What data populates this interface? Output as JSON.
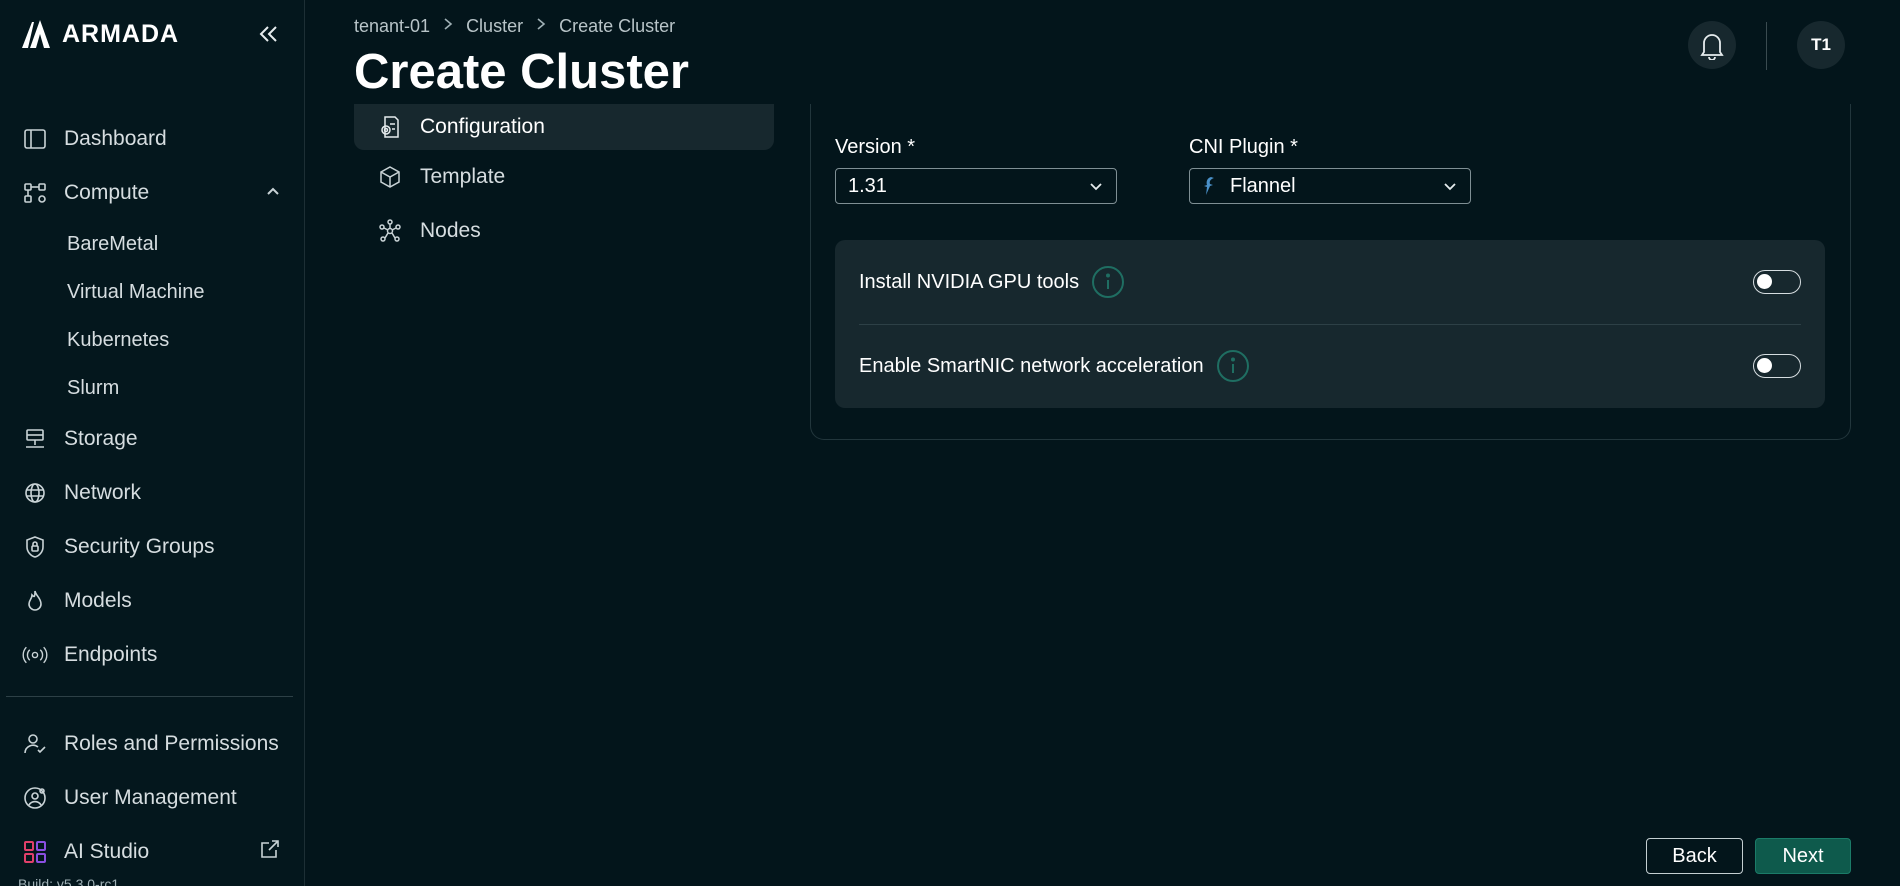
{
  "brand": {
    "name": "ARMADA"
  },
  "sidebar": {
    "items": [
      {
        "label": "Dashboard",
        "icon": "dashboard-icon"
      },
      {
        "label": "Compute",
        "icon": "compute-icon",
        "expanded": true,
        "children": [
          "BareMetal",
          "Virtual Machine",
          "Kubernetes",
          "Slurm"
        ]
      },
      {
        "label": "Storage",
        "icon": "storage-icon"
      },
      {
        "label": "Network",
        "icon": "globe-icon"
      },
      {
        "label": "Security Groups",
        "icon": "lock-shield-icon"
      },
      {
        "label": "Models",
        "icon": "flame-icon"
      },
      {
        "label": "Endpoints",
        "icon": "broadcast-icon"
      }
    ],
    "bottom_items": [
      {
        "label": "Roles and Permissions",
        "icon": "users-check-icon"
      },
      {
        "label": "User Management",
        "icon": "user-gear-icon"
      },
      {
        "label": "AI Studio",
        "icon": "grid-apps-icon",
        "external": true
      }
    ],
    "build": "Build: v5.3.0-rc1"
  },
  "header": {
    "breadcrumb": [
      "tenant-01",
      "Cluster",
      "Create Cluster"
    ],
    "title": "Create Cluster",
    "avatar": "T1"
  },
  "steps": [
    {
      "label": "Configuration",
      "icon": "config-icon",
      "active": true
    },
    {
      "label": "Template",
      "icon": "cube-icon",
      "active": false
    },
    {
      "label": "Nodes",
      "icon": "nodes-icon",
      "active": false
    }
  ],
  "form": {
    "version": {
      "label": "Version *",
      "value": "1.31"
    },
    "cni": {
      "label": "CNI Plugin *",
      "value": "Flannel"
    },
    "options": [
      {
        "label": "Install NVIDIA GPU tools",
        "enabled": false
      },
      {
        "label": "Enable SmartNIC network acceleration",
        "enabled": false
      }
    ]
  },
  "footer": {
    "back": "Back",
    "next": "Next"
  },
  "colors": {
    "background": "#03151b",
    "panel": "#17282e",
    "accent": "#0e5a4c",
    "info": "#1f6e62"
  }
}
